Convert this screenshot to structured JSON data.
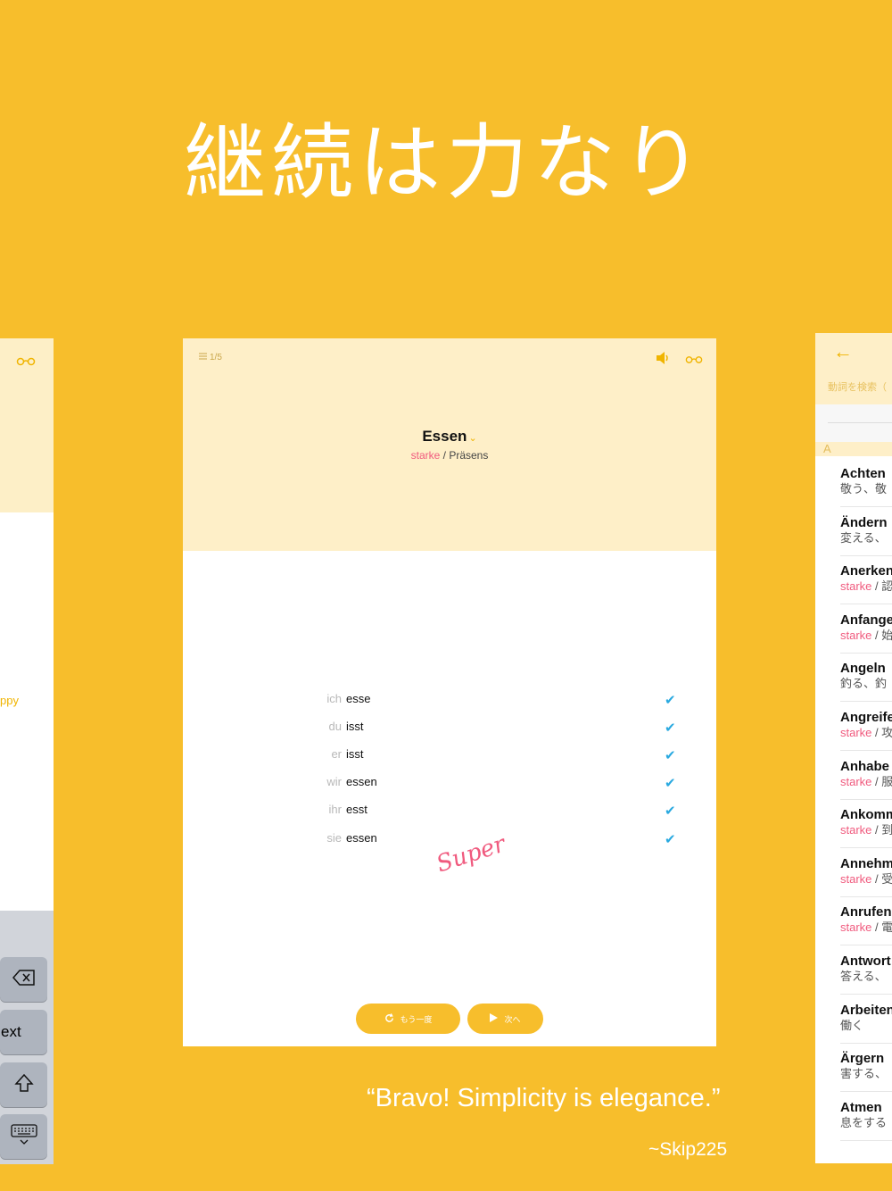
{
  "headline": "継続は力なり",
  "left_screen": {
    "partial_text": "ppy",
    "keyboard": {
      "next_label": "ext"
    }
  },
  "center_screen": {
    "progress": "1/5",
    "verb": "Essen",
    "verb_type": "starke",
    "tense": "Präsens",
    "separator": " / ",
    "conjugations": [
      {
        "pronoun": "ich",
        "form": "esse",
        "correct": true
      },
      {
        "pronoun": "du",
        "form": "isst",
        "correct": true
      },
      {
        "pronoun": "er",
        "form": "isst",
        "correct": true
      },
      {
        "pronoun": "wir",
        "form": "essen",
        "correct": true
      },
      {
        "pronoun": "ihr",
        "form": "esst",
        "correct": true
      },
      {
        "pronoun": "sie",
        "form": "essen",
        "correct": true
      }
    ],
    "feedback": "Super!",
    "retry_label": "もう一度",
    "next_label": "次へ"
  },
  "right_screen": {
    "search_placeholder": "動詞を検索（",
    "section_letter": "A",
    "items": [
      {
        "word": "Achten",
        "type": "",
        "meaning": "敬う、敬"
      },
      {
        "word": "Ändern",
        "type": "",
        "meaning": "変える、"
      },
      {
        "word": "Anerken",
        "type": "starke",
        "meaning": " / 認"
      },
      {
        "word": "Anfange",
        "type": "starke",
        "meaning": " / 始"
      },
      {
        "word": "Angeln",
        "type": "",
        "meaning": "釣る、釣"
      },
      {
        "word": "Angreife",
        "type": "starke",
        "meaning": " / 攻"
      },
      {
        "word": "Anhabe",
        "type": "starke",
        "meaning": " / 服"
      },
      {
        "word": "Ankomm",
        "type": "starke",
        "meaning": " / 到"
      },
      {
        "word": "Annehm",
        "type": "starke",
        "meaning": " / 受"
      },
      {
        "word": "Anrufen",
        "type": "starke",
        "meaning": " / 電"
      },
      {
        "word": "Antwort",
        "type": "",
        "meaning": "答える、"
      },
      {
        "word": "Arbeiten",
        "type": "",
        "meaning": "働く"
      },
      {
        "word": "Ärgern",
        "type": "",
        "meaning": "害する、"
      },
      {
        "word": "Atmen",
        "type": "",
        "meaning": "息をする"
      }
    ]
  },
  "quote": "“Bravo! Simplicity is elegance.”",
  "author": "~Skip225",
  "colors": {
    "background": "#F7BE2C",
    "header": "#FEEFC8",
    "strong": "#F05A7E",
    "check": "#29A9E0"
  }
}
